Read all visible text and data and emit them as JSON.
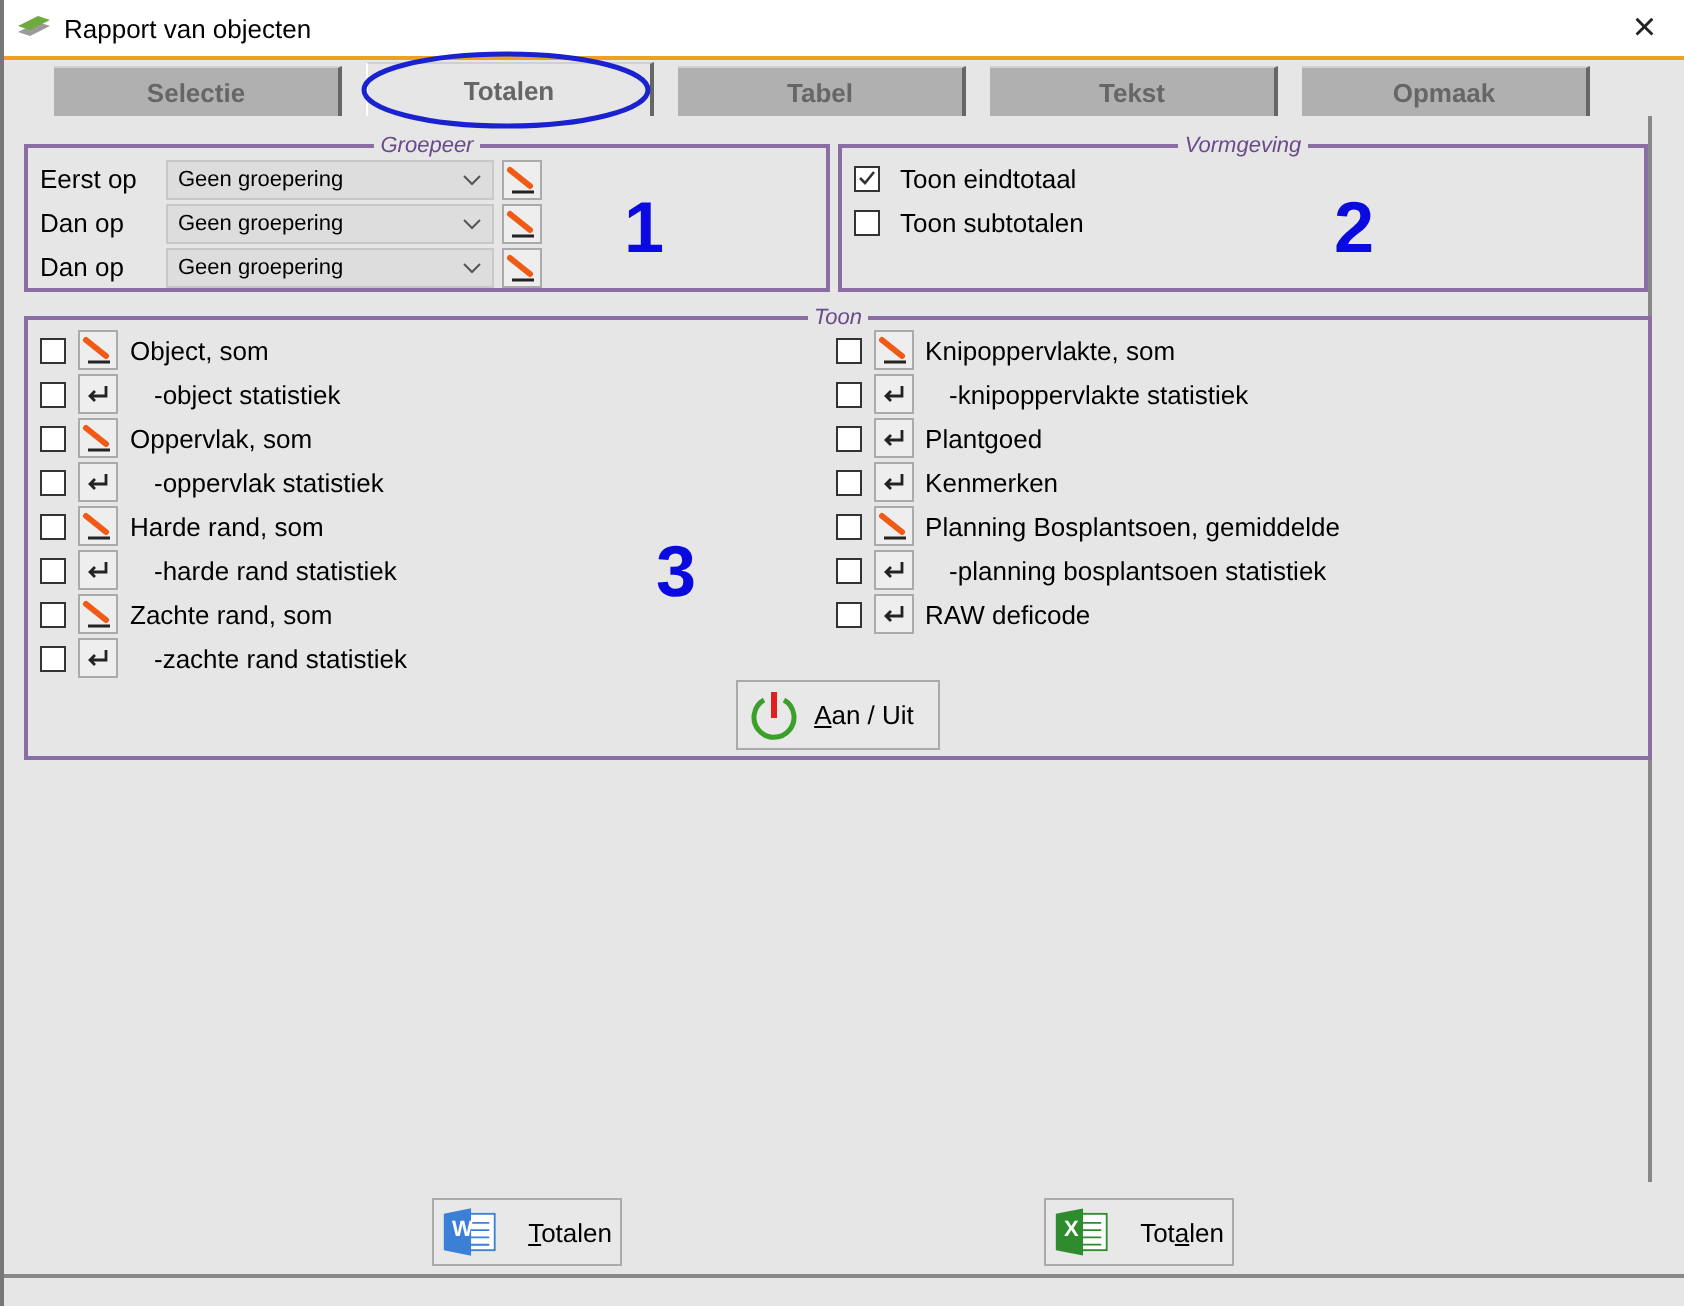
{
  "window": {
    "title": "Rapport van objecten",
    "close": "×"
  },
  "tabs": [
    {
      "label": "Selectie",
      "selected": false
    },
    {
      "label": "Totalen",
      "selected": true
    },
    {
      "label": "Tabel",
      "selected": false
    },
    {
      "label": "Tekst",
      "selected": false
    },
    {
      "label": "Opmaak",
      "selected": false
    }
  ],
  "groepeer": {
    "legend": "Groepeer",
    "annotation": "1",
    "rows": [
      {
        "label": "Eerst op",
        "value": "Geen groepering"
      },
      {
        "label": "Dan op",
        "value": "Geen groepering"
      },
      {
        "label": "Dan op",
        "value": "Geen groepering"
      }
    ]
  },
  "vormgeving": {
    "legend": "Vormgeving",
    "annotation": "2",
    "options": [
      {
        "label": "Toon eindtotaal",
        "checked": true
      },
      {
        "label": "Toon subtotalen",
        "checked": false
      }
    ]
  },
  "toon": {
    "legend": "Toon",
    "annotation": "3",
    "columns": [
      [
        {
          "label": "Object, som",
          "kind": "sum",
          "checked": false
        },
        {
          "label": "-object statistiek",
          "kind": "stat",
          "checked": false
        },
        {
          "label": "Oppervlak, som",
          "kind": "sum",
          "checked": false
        },
        {
          "label": "-oppervlak statistiek",
          "kind": "stat",
          "checked": false
        },
        {
          "label": "Harde rand, som",
          "kind": "sum",
          "checked": false
        },
        {
          "label": "-harde rand statistiek",
          "kind": "stat",
          "checked": false
        },
        {
          "label": "Zachte rand, som",
          "kind": "sum",
          "checked": false
        },
        {
          "label": "-zachte rand statistiek",
          "kind": "stat",
          "checked": false
        }
      ],
      [
        {
          "label": "Knipoppervlakte, som",
          "kind": "sum",
          "checked": false
        },
        {
          "label": "-knipoppervlakte statistiek",
          "kind": "stat",
          "checked": false
        },
        {
          "label": "Plantgoed",
          "kind": "field",
          "checked": false
        },
        {
          "label": "Kenmerken",
          "kind": "field",
          "checked": false
        },
        {
          "label": "Planning Bosplantsoen, gemiddelde",
          "kind": "sum",
          "checked": false
        },
        {
          "label": "-planning bosplantsoen statistiek",
          "kind": "stat",
          "checked": false
        },
        {
          "label": "RAW deficode",
          "kind": "field",
          "checked": false
        }
      ]
    ],
    "toggle_button": {
      "label_parts": [
        {
          "text": "A",
          "underlined": true
        },
        {
          "text": "an / Uit",
          "underlined": false
        }
      ]
    }
  },
  "export_buttons": [
    {
      "kind": "word",
      "icon_letter": "W",
      "label_parts": [
        {
          "text": "T",
          "underlined": true
        },
        {
          "text": "otalen",
          "underlined": false
        }
      ]
    },
    {
      "kind": "excel",
      "icon_letter": "X",
      "label_parts": [
        {
          "text": "Tot",
          "underlined": false
        },
        {
          "text": "a",
          "underlined": true
        },
        {
          "text": "len",
          "underlined": false
        }
      ]
    }
  ]
}
